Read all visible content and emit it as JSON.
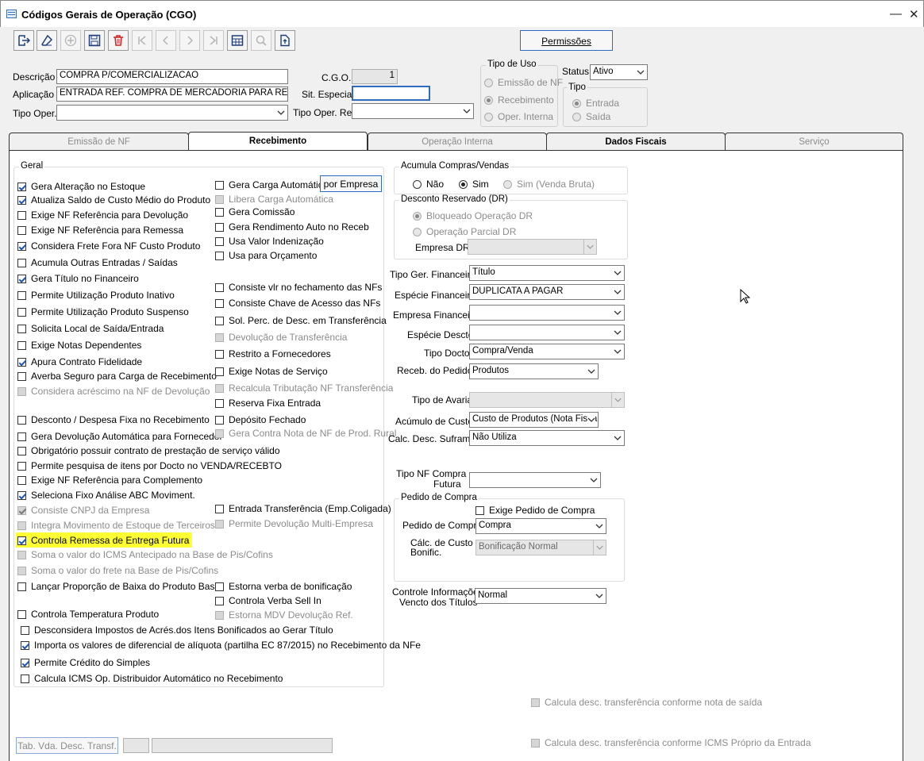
{
  "window": {
    "title": "Códigos Gerais de Operação (CGO)",
    "min": "—",
    "close": "✕"
  },
  "toolbar": {
    "permissoes": "Permissões"
  },
  "header": {
    "descricao_label": "Descrição",
    "descricao_value": "COMPRA P/COMERCIALIZACAO",
    "cgo_label": "C.G.O.",
    "cgo_value": "1",
    "aplicacao_label": "Aplicação",
    "aplicacao_value": "ENTRADA REF. COMPRA DE MERCADORIA PARA REVE",
    "sit_especial_label": "Sit. Especial",
    "sit_especial_value": "",
    "tipo_oper_label": "Tipo Oper.",
    "tipo_oper_value": "",
    "tipo_oper_rel_label": "Tipo Oper. Rel.",
    "tipo_oper_rel_value": "",
    "tipo_uso_title": "Tipo de Uso",
    "tipo_uso": [
      "Emissão de NF",
      "Recebimento",
      "Oper. Interna"
    ],
    "status_label": "Status",
    "status_value": "Ativo",
    "tipo_title": "Tipo",
    "tipo": [
      "Entrada",
      "Saída"
    ]
  },
  "tabs": [
    "Emissão de NF",
    "Recebimento",
    "Operação Interna",
    "Dados Fiscais",
    "Serviço"
  ],
  "geral": {
    "title": "Geral",
    "por_empresa": "por Empresa",
    "left": [
      {
        "label": "Gera Alteração no Estoque",
        "checked": true
      },
      {
        "label": "Atualiza Saldo de Custo Médio do Produto",
        "checked": true
      },
      {
        "label": "Exige NF Referência para Devolução",
        "checked": false
      },
      {
        "label": "Exige NF Referência para Remessa",
        "checked": false
      },
      {
        "label": "Considera Frete Fora NF Custo Produto",
        "checked": true
      },
      {
        "label": "Acumula Outras Entradas / Saídas",
        "checked": false
      },
      {
        "label": "Gera Título no Financeiro",
        "checked": true
      },
      {
        "label": "Permite Utilização Produto Inativo",
        "checked": false
      },
      {
        "label": "Permite Utilização Produto Suspenso",
        "checked": false
      },
      {
        "label": "Solicita Local de Saída/Entrada",
        "checked": false
      },
      {
        "label": "Exige Notas Dependentes",
        "checked": false
      },
      {
        "label": "Apura Contrato Fidelidade",
        "checked": true
      },
      {
        "label": "Averba Seguro para Carga de Recebimento",
        "checked": false
      },
      {
        "label": "Considera acréscimo na NF de Devolução",
        "checked": false,
        "disabled": true
      },
      {
        "label": "Desconto / Despesa Fixa no Recebimento",
        "checked": false
      },
      {
        "label": "Gera Devolução Automática para Fornecedor",
        "checked": false
      },
      {
        "label": "Obrigatório possuir contrato de prestação de serviço válido",
        "checked": false
      },
      {
        "label": "Permite pesquisa de itens por Docto no VENDA/RECEBTO",
        "checked": false
      },
      {
        "label": "Exige NF Referência para Complemento",
        "checked": false
      },
      {
        "label": "Seleciona Fixo Análise ABC Moviment.",
        "checked": true
      },
      {
        "label": "Consiste CNPJ da Empresa",
        "checked": true,
        "disabled": true
      },
      {
        "label": "Integra Movimento de Estoque de Terceiros",
        "checked": false,
        "disabled": true
      },
      {
        "label": "Controla Remessa de Entrega Futura",
        "checked": true
      },
      {
        "label": "Soma o valor do ICMS Antecipado na Base de Pis/Cofins",
        "checked": false,
        "disabled": true
      },
      {
        "label": "Soma o valor do frete na Base de Pis/Cofins",
        "checked": false,
        "disabled": true
      },
      {
        "label": "Lançar Proporção de Baixa do Produto Base",
        "checked": false
      },
      {
        "label": "Controla Temperatura Produto",
        "checked": false
      },
      {
        "label": "Desconsidera Impostos de Acrés.dos Itens Bonificados ao Gerar Título",
        "checked": false
      },
      {
        "label": "Importa os valores de diferencial de alíquota (partilha EC 87/2015) no Recebimento da NFe",
        "checked": true
      },
      {
        "label": "Permite Crédito do Simples",
        "checked": true
      },
      {
        "label": "Calcula ICMS Op. Distribuidor Automático no Recebimento",
        "checked": false
      }
    ],
    "right": [
      {
        "label": "Gera Carga Automática",
        "checked": false
      },
      {
        "label": "Libera Carga Automática",
        "checked": false,
        "disabled": true
      },
      {
        "label": "Gera Comissão",
        "checked": false
      },
      {
        "label": "Gera Rendimento Auto no Receb",
        "checked": false
      },
      {
        "label": "Usa Valor Indenização",
        "checked": false
      },
      {
        "label": "Usa para Orçamento",
        "checked": false
      },
      {
        "label": "Consiste vlr no fechamento das NFs",
        "checked": false
      },
      {
        "label": "Consiste Chave de Acesso das NFs",
        "checked": false
      },
      {
        "label": "Sol. Perc. de Desc. em Transferência",
        "checked": false
      },
      {
        "label": "Devolução de Transferência",
        "checked": false,
        "disabled": true
      },
      {
        "label": "Restrito a Fornecedores",
        "checked": false
      },
      {
        "label": "Exige Notas de Serviço",
        "checked": false
      },
      {
        "label": "Recalcula Tributação NF Transferência",
        "checked": false,
        "disabled": true
      },
      {
        "label": "Reserva Fixa Entrada",
        "checked": false
      },
      {
        "label": "Depósito Fechado",
        "checked": false
      },
      {
        "label": "Gera Contra Nota de NF de Prod. Rural",
        "checked": false,
        "disabled": true
      },
      {
        "label": "Entrada Transferência (Emp.Coligada)",
        "checked": false
      },
      {
        "label": "Permite Devolução Multi-Empresa",
        "checked": false,
        "disabled": true
      },
      {
        "label": "Estorna verba de bonificação",
        "checked": false
      },
      {
        "label": "Controla Verba Sell In",
        "checked": false
      },
      {
        "label": "Estorna MDV Devolução Ref.",
        "checked": false,
        "disabled": true
      }
    ]
  },
  "acumula": {
    "title": "Acumula Compras/Vendas",
    "options": [
      "Não",
      "Sim",
      "Sim (Venda Bruta)"
    ]
  },
  "desconto": {
    "title": "Desconto Reservado (DR)",
    "options": [
      "Bloqueado Operação DR",
      "Operação Parcial DR"
    ],
    "empresa_label": "Empresa DR"
  },
  "financeiro": {
    "tipo_ger_label": "Tipo Ger. Financeiro",
    "tipo_ger_value": "Título",
    "especie_label": "Espécie Financeira",
    "especie_value": "DUPLICATA A PAGAR",
    "empresa_label": "Empresa Financeiro",
    "empresa_value": "",
    "especie_desc_label": "Espécie Descto",
    "especie_desc_value": "",
    "tipo_docto_label": "Tipo Docto",
    "tipo_docto_value": "Compra/Venda",
    "receb_pedido_label": "Receb. do Pedido",
    "receb_pedido_value": "Produtos",
    "tipo_avaria_label": "Tipo de Avaria",
    "tipo_avaria_value": "",
    "acumulo_label": "Acúmulo de Custo",
    "acumulo_value": "Custo de Produtos (Nota Fiscal)",
    "calc_suframa_label": "Calc. Desc. Suframa",
    "calc_suframa_value": "Não Utiliza",
    "tipo_nf_label1": "Tipo NF Compra",
    "tipo_nf_label2": "Futura",
    "tipo_nf_value": ""
  },
  "pedido": {
    "title": "Pedido de Compra",
    "exige_label": "Exige Pedido de Compra",
    "pedido_label": "Pedido de Compra",
    "pedido_value": "Compra",
    "calc_label1": "Cálc. de Custo",
    "calc_label2": "Bonific.",
    "calc_value": "Bonificação Normal"
  },
  "controle": {
    "label1": "Controle Informações",
    "label2": "Vencto dos Títulos",
    "value": "Normal"
  },
  "bottom": {
    "calc_desc_saida": "Calcula desc. transferência conforme nota de saída",
    "calc_desc_icms": "Calcula desc. transferência conforme ICMS Próprio da Entrada",
    "tab_vda": "Tab. Vda. Desc. Transf."
  },
  "colors": {
    "highlight": "#ffff33",
    "accent": "#1e56b6"
  }
}
